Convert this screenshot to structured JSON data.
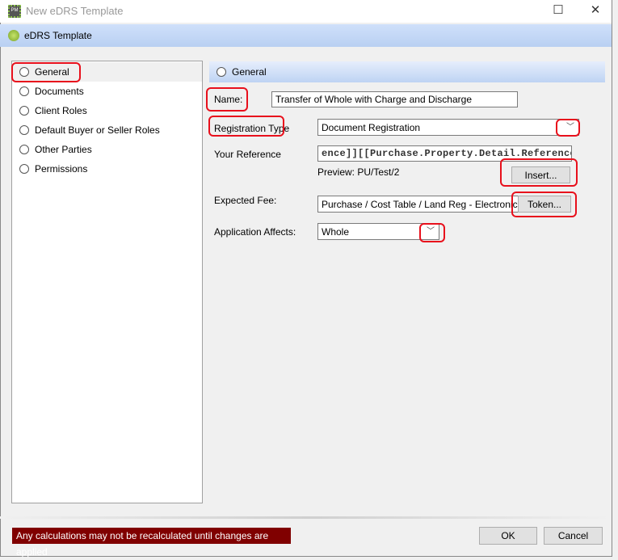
{
  "window": {
    "title": "New eDRS Template",
    "icon_text": "PM"
  },
  "header": {
    "title": "eDRS Template"
  },
  "sidebar": {
    "items": [
      {
        "label": "General",
        "selected": true
      },
      {
        "label": "Documents"
      },
      {
        "label": "Client Roles"
      },
      {
        "label": "Default Buyer or Seller Roles"
      },
      {
        "label": "Other Parties"
      },
      {
        "label": "Permissions"
      }
    ]
  },
  "section": {
    "title": "General"
  },
  "form": {
    "name_label": "Name:",
    "name_value": "Transfer of Whole with Charge and Discharge",
    "regtype_label": "Registration Type",
    "regtype_value": "Document Registration",
    "ref_label": "Your Reference",
    "ref_value": "ence]][[Purchase.Property.Detail.Reference]]",
    "preview": "Preview: PU/Test/2",
    "insert_label": "Insert...",
    "fee_label": "Expected Fee:",
    "fee_value": "Purchase / Cost Table / Land Reg - Electronic / Band",
    "token_label": "Token...",
    "affects_label": "Application Affects:",
    "affects_value": "Whole"
  },
  "footer": {
    "warning": "Any calculations may not be recalculated until changes are applied",
    "ok": "OK",
    "cancel": "Cancel"
  },
  "colors": {
    "annotation": "#e8101c",
    "warning_bg": "#800000"
  }
}
